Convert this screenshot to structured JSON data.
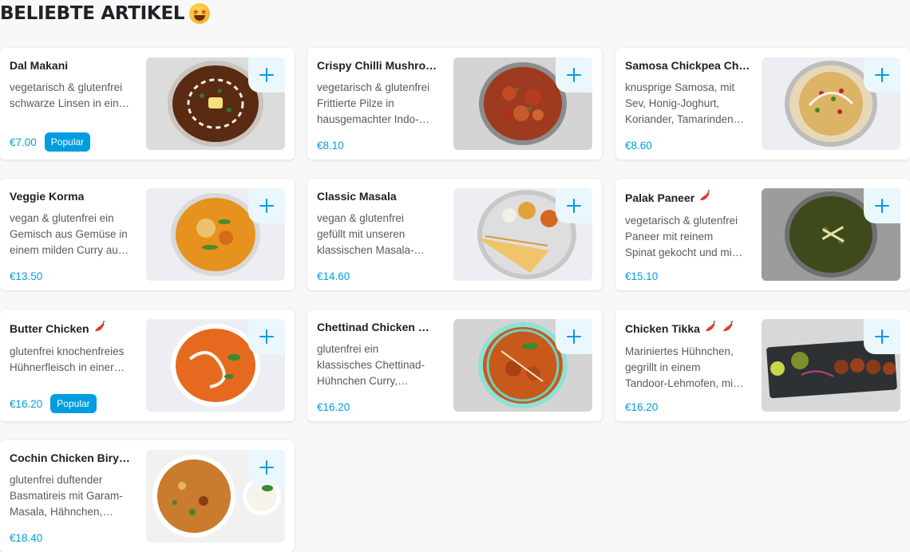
{
  "section": {
    "title": "BELIEBTE ARTIKEL",
    "emoji": "star-struck-face"
  },
  "colors": {
    "accent": "#009de0",
    "add_button_bg": "#eaf7fd",
    "text_primary": "#202125",
    "text_secondary": "#5a5a60"
  },
  "items": [
    {
      "name": "Dal Makani",
      "spicy": 0,
      "description": "vegetarisch & glutenfrei\nschwarze Linsen in ein…",
      "price": "€7.00",
      "badge": "Popular",
      "image": "dal-makhani-bowl"
    },
    {
      "name": "Crispy Chilli Mushro…",
      "spicy": 0,
      "description": "vegetarisch & glutenfrei\nFrittierte Pilze in\nhausgemachter Indo-…",
      "price": "€8.10",
      "badge": "",
      "image": "chilli-mushroom-plate"
    },
    {
      "name": "Samosa Chickpea Ch…",
      "spicy": 0,
      "description": "knusprige Samosa, mit\nSev, Honig-Joghurt,\nKoriander, Tamarinden…",
      "price": "€8.60",
      "badge": "",
      "image": "samosa-chaat-plate"
    },
    {
      "name": "Veggie Korma",
      "spicy": 0,
      "description": "vegan & glutenfrei ein\nGemisch aus Gemüse in\neinem milden Curry au…",
      "price": "€13.50",
      "badge": "",
      "image": "veggie-korma-bowl"
    },
    {
      "name": "Classic Masala",
      "spicy": 0,
      "description": "vegan & glutenfrei\ngefüllt mit unseren\nklassischen Masala-…",
      "price": "€14.60",
      "badge": "",
      "image": "masala-dosa-thali"
    },
    {
      "name": "Palak Paneer",
      "spicy": 1,
      "description": "vegetarisch & glutenfrei\nPaneer mit reinem\nSpinat gekocht und mi…",
      "price": "€15.10",
      "badge": "",
      "image": "palak-paneer-bowl"
    },
    {
      "name": "Butter Chicken",
      "spicy": 1,
      "description": "glutenfrei knochenfreies\nHühnerfleisch in einer…",
      "price": "€16.20",
      "badge": "Popular",
      "image": "butter-chicken-bowl"
    },
    {
      "name": "Chettinad Chicken …",
      "spicy": 0,
      "description": "glutenfrei ein\nklassisches Chettinad-\nHühnchen Curry,…",
      "price": "€16.20",
      "badge": "",
      "image": "chettinad-chicken-bowl"
    },
    {
      "name": "Chicken Tikka",
      "spicy": 2,
      "description": "Mariniertes Hühnchen,\ngegrillt in einem\nTandoor-Lehmofen, mi…",
      "price": "€16.20",
      "badge": "",
      "image": "chicken-tikka-slate"
    },
    {
      "name": "Cochin Chicken Biry…",
      "spicy": 0,
      "description": "glutenfrei duftender\nBasmatireis mit Garam-\nMasala, Hähnchen,…",
      "price": "€18.40",
      "badge": "",
      "image": "chicken-biryani-bowl"
    }
  ]
}
